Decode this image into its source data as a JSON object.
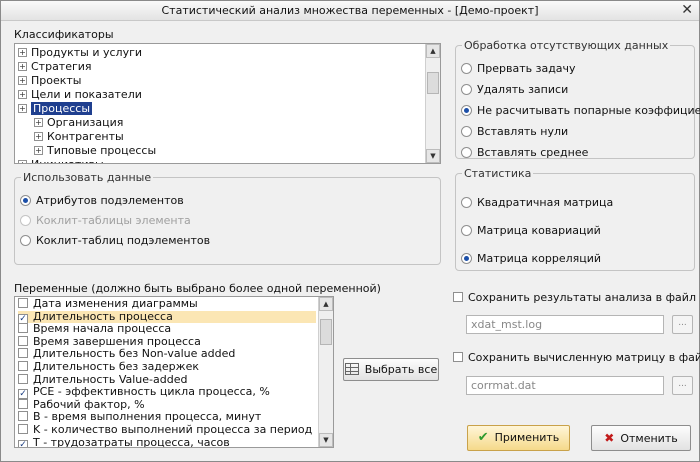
{
  "window": {
    "title": "Статистический анализ множества переменных - [Демо-проект]",
    "close_glyph": "✕"
  },
  "classifiers": {
    "label": "Классификаторы",
    "items": [
      {
        "label": "Продукты и услуги",
        "level": 0,
        "selected": false
      },
      {
        "label": "Стратегия",
        "level": 0,
        "selected": false
      },
      {
        "label": "Проекты",
        "level": 0,
        "selected": false
      },
      {
        "label": "Цели и показатели",
        "level": 0,
        "selected": false
      },
      {
        "label": "Процессы",
        "level": 0,
        "selected": true
      },
      {
        "label": "Организация",
        "level": 1,
        "selected": false
      },
      {
        "label": "Контрагенты",
        "level": 1,
        "selected": false
      },
      {
        "label": "Типовые процессы",
        "level": 1,
        "selected": false
      },
      {
        "label": "Инициативы",
        "level": 0,
        "selected": false
      }
    ]
  },
  "missing_data": {
    "legend": "Обработка отсутствующих данных",
    "options": [
      {
        "label": "Прервать задачу",
        "selected": false
      },
      {
        "label": "Удалять записи",
        "selected": false
      },
      {
        "label": "Не расчитывать попарные коэффициенты",
        "selected": true
      },
      {
        "label": "Вставлять нули",
        "selected": false
      },
      {
        "label": "Вставлять среднее",
        "selected": false
      }
    ]
  },
  "use_data": {
    "legend": "Использовать данные",
    "options": [
      {
        "label": "Атрибутов подэлементов",
        "selected": true,
        "disabled": false
      },
      {
        "label": "Коклит-таблицы элемента",
        "selected": false,
        "disabled": true
      },
      {
        "label": "Коклит-таблиц подэлементов",
        "selected": false,
        "disabled": false
      }
    ]
  },
  "statistics": {
    "legend": "Статистика",
    "options": [
      {
        "label": "Квадратичная матрица",
        "selected": false
      },
      {
        "label": "Матрица ковариаций",
        "selected": false
      },
      {
        "label": "Матрица корреляций",
        "selected": true
      }
    ]
  },
  "variables": {
    "label": "Переменные (должно быть выбрано более одной переменной)",
    "items": [
      {
        "label": "Дата изменения диаграммы",
        "checked": false,
        "highlight": false
      },
      {
        "label": "Длительность процесса",
        "checked": true,
        "highlight": true
      },
      {
        "label": "Время начала процесса",
        "checked": false,
        "highlight": false
      },
      {
        "label": "Время завершения процесса",
        "checked": false,
        "highlight": false
      },
      {
        "label": "Длительность без Non-value added",
        "checked": false,
        "highlight": false
      },
      {
        "label": "Длительность без задержек",
        "checked": false,
        "highlight": false
      },
      {
        "label": "Длительность Value-added",
        "checked": false,
        "highlight": false
      },
      {
        "label": "PCE - эффективность цикла процесса, %",
        "checked": true,
        "highlight": false
      },
      {
        "label": "Рабочий фактор, %",
        "checked": false,
        "highlight": false
      },
      {
        "label": "B - время выполнения процесса, минут",
        "checked": false,
        "highlight": false
      },
      {
        "label": "K - количество выполнений процесса за период",
        "checked": false,
        "highlight": false
      },
      {
        "label": "T - трудозатраты процесса, часов",
        "checked": true,
        "highlight": false
      }
    ],
    "check_glyph": "✓"
  },
  "select_all_label": "Выбрать все",
  "save_results": {
    "label": "Сохранить результаты анализа в файл",
    "checked": false,
    "file": "xdat_mst.log"
  },
  "save_matrix": {
    "label": "Сохранить вычисленную матрицу в файл",
    "checked": false,
    "file": "corrmat.dat"
  },
  "browse_label": "...",
  "apply_label": "Применить",
  "cancel_label": "Отменить",
  "icons": {
    "apply": "✔",
    "cancel": "✖"
  }
}
